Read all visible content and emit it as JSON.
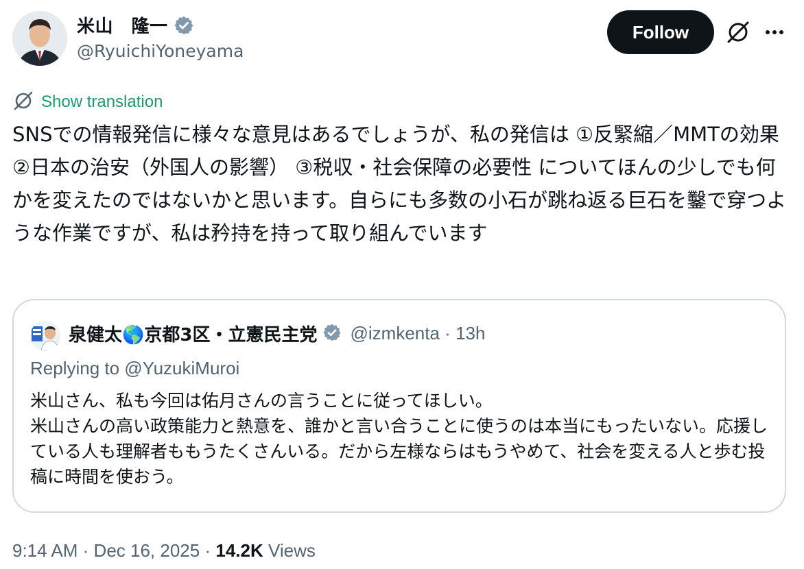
{
  "author": {
    "display_name": "米山　隆一",
    "handle": "@RyuichiYoneyama"
  },
  "actions": {
    "follow_label": "Follow",
    "grok_icon": "grok-icon",
    "more_icon": "more-icon"
  },
  "translation": {
    "label": "Show translation"
  },
  "tweet": {
    "text": "SNSでの情報発信に様々な意見はあるでしょうが、私の発信は ①反緊縮／MMTの効果 ②日本の治安（外国人の影響） ③税収・社会保障の必要性 についてほんの少しでも何かを変えたのではないかと思います。自らにも多数の小石が跳ね返る巨石を鑿で穿つような作業ですが、私は矜持を持って取り組んでいます"
  },
  "quote": {
    "display_name_part1": "泉健太",
    "display_name_emoji": "🌎",
    "display_name_part2": "京都3区・立憲民主党",
    "handle": "@izmkenta",
    "separator": "·",
    "time": "13h",
    "replying_to": "Replying to @YuzukiMuroi",
    "text": "米山さん、私も今回は佑月さんの言うことに従ってほしい。\n米山さんの高い政策能力と熱意を、誰かと言い合うことに使うのは本当にもったいない。応援している人も理解者ももうたくさんいる。だから左様ならはもうやめて、社会を変える人と歩む投稿に時間を使おう。"
  },
  "meta": {
    "time": "9:14 AM",
    "date": "Dec 16, 2025",
    "separator": "·",
    "views_count": "14.2K",
    "views_label": "Views"
  },
  "colors": {
    "text": "#0f1419",
    "secondary": "#536471",
    "verified": "#829aab",
    "translate": "#1d9b6c",
    "border": "#cfd9de",
    "button": "#0f1419"
  }
}
